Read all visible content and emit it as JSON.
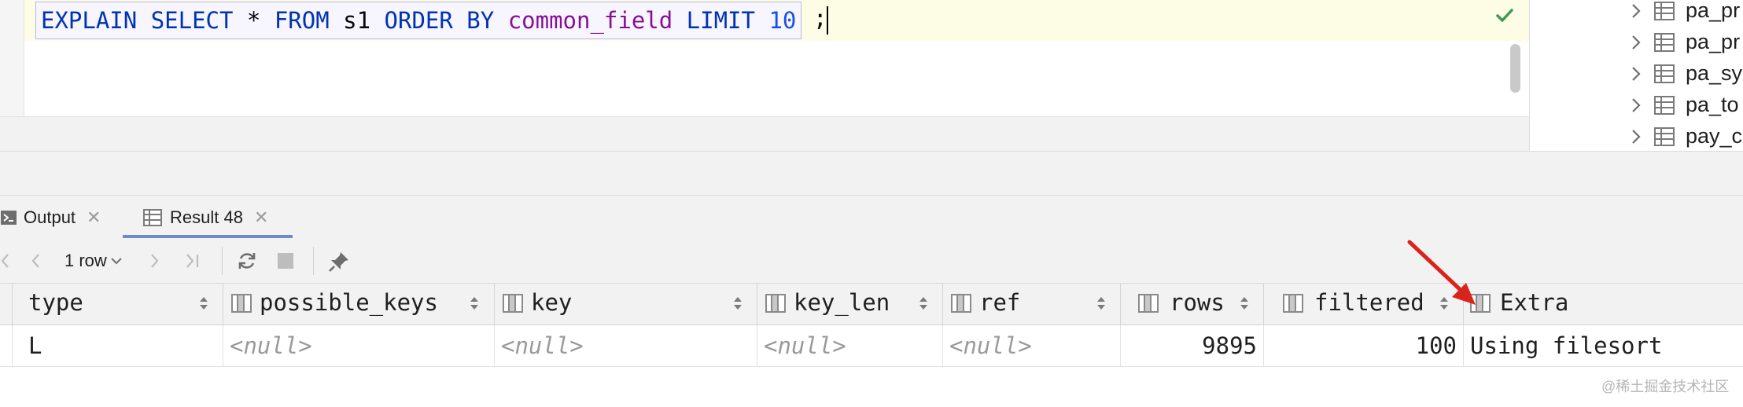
{
  "editor": {
    "sql_tokens": [
      {
        "text": "EXPLAIN",
        "kind": "kw"
      },
      {
        "text": " ",
        "kind": "plain"
      },
      {
        "text": "SELECT",
        "kind": "kw"
      },
      {
        "text": " * ",
        "kind": "plain"
      },
      {
        "text": "FROM",
        "kind": "kw"
      },
      {
        "text": " s1 ",
        "kind": "plain"
      },
      {
        "text": "ORDER BY",
        "kind": "kw"
      },
      {
        "text": " ",
        "kind": "plain"
      },
      {
        "text": "common_field",
        "kind": "fld"
      },
      {
        "text": " ",
        "kind": "plain"
      },
      {
        "text": "LIMIT",
        "kind": "kw"
      },
      {
        "text": " ",
        "kind": "plain"
      },
      {
        "text": "10",
        "kind": "num"
      }
    ],
    "semicolon": ";",
    "status_icon": "check-icon",
    "status_color": "#3d9a50"
  },
  "tree": {
    "items": [
      {
        "label": "pa_pr"
      },
      {
        "label": "pa_pr"
      },
      {
        "label": "pa_sy"
      },
      {
        "label": "pa_to"
      },
      {
        "label": "pay_c"
      }
    ]
  },
  "tabs": [
    {
      "label": "Output",
      "icon": "console-icon",
      "active": false
    },
    {
      "label": "Result 48",
      "icon": "table-icon",
      "active": true
    }
  ],
  "toolbar": {
    "row_count": "1 row",
    "icons": [
      "first-page-icon",
      "prev-page-icon",
      "next-page-icon",
      "last-page-icon",
      "refresh-icon",
      "stop-icon",
      "pin-icon"
    ]
  },
  "grid": {
    "columns": [
      "type",
      "possible_keys",
      "key",
      "key_len",
      "ref",
      "rows",
      "filtered",
      "Extra"
    ],
    "row": {
      "type": "L",
      "possible_keys": "<null>",
      "key": "<null>",
      "key_len": "<null>",
      "ref": "<null>",
      "rows": "9895",
      "filtered": "100",
      "Extra": "Using filesort"
    }
  },
  "annotation": {
    "arrow_color": "#d9241c"
  },
  "watermark": "@稀土掘金技术社区"
}
